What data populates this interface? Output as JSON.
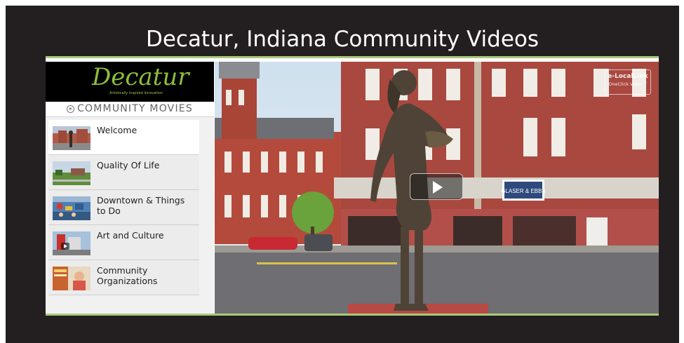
{
  "page": {
    "title": "Decatur, Indiana Community Videos"
  },
  "logo": {
    "text": "Decatur",
    "tagline": "Artistically Inspired Innovation"
  },
  "sidebar": {
    "header": "COMMUNITY MOVIES",
    "items": [
      {
        "label": "Welcome",
        "active": true
      },
      {
        "label": "Quality Of Life",
        "active": false
      },
      {
        "label": "Downtown & Things to Do",
        "active": false
      },
      {
        "label": "Art and Culture",
        "active": false
      },
      {
        "label": "Community Organizations",
        "active": false
      }
    ]
  },
  "video": {
    "watermark_line1": "e-LocalLink",
    "watermark_line2": "OneClick Video™",
    "storefront_sign": "GLASER & EBBS",
    "play_icon": "play-icon"
  },
  "colors": {
    "background": "#231f20",
    "accent": "#a9c97a",
    "logo_green": "#8fbf3a"
  }
}
